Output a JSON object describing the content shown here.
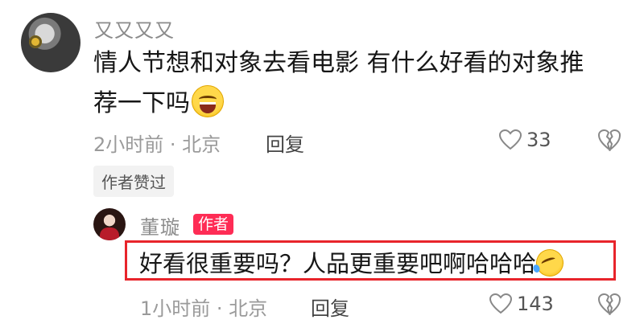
{
  "comment": {
    "username": "又又又又",
    "text_line1": "情人节想和对象去看电影 有什么好看的对象推",
    "text_line2": "荐一下吗",
    "time_location": "2小时前 · 北京",
    "reply_label": "回复",
    "like_count": "33",
    "author_liked_tag": "作者赞过"
  },
  "reply": {
    "username": "董璇",
    "author_badge": "作者",
    "text": "好看很重要吗？人品更重要吧啊哈哈哈",
    "time_location": "1小时前 · 北京",
    "reply_label": "回复",
    "like_count": "143"
  },
  "colors": {
    "highlight_border": "#e8242b",
    "author_badge_bg": "#fe2c55",
    "meta_text": "#9a9a9a"
  },
  "icons": {
    "like": "heart-outline-icon",
    "dislike": "broken-heart-icon",
    "emoji1": "laughing-emoji-icon",
    "emoji2": "rolling-on-floor-laughing-emoji-icon"
  }
}
